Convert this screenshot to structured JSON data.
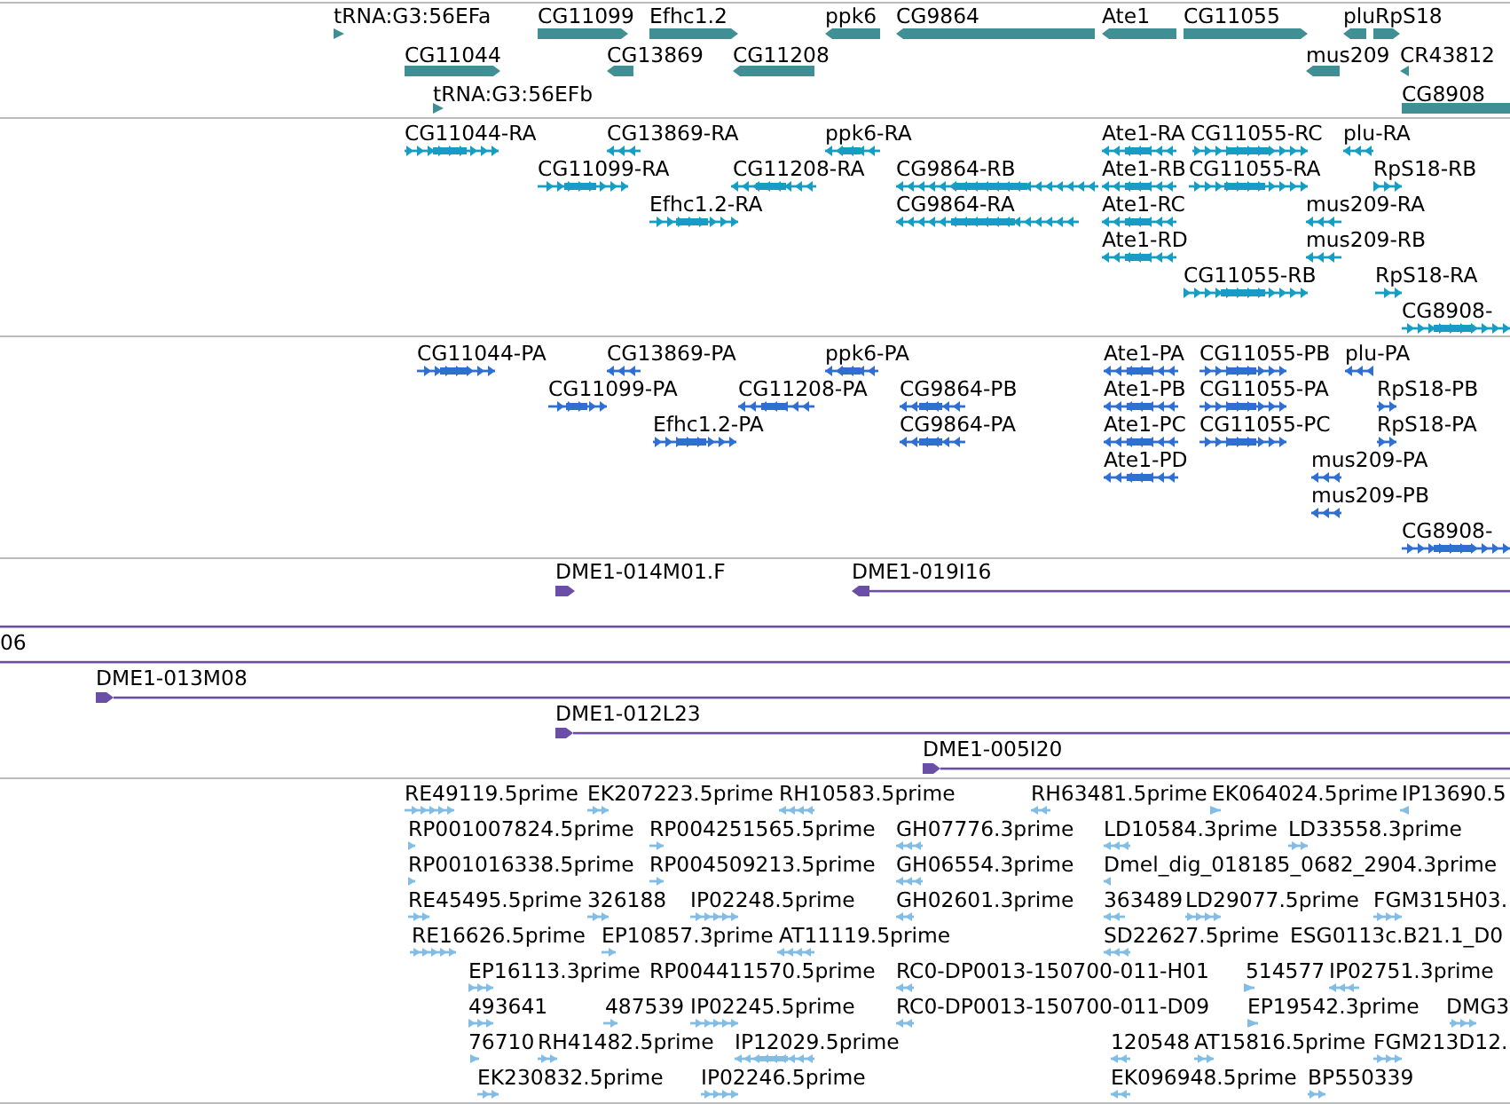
{
  "tracks": [
    {
      "kind": "gene",
      "features": [
        {
          "label": "tRNA:G3:56EFa",
          "reverse": false
        },
        {
          "label": "CG11099",
          "reverse": false
        },
        {
          "label": "Efhc1.2",
          "reverse": false
        },
        {
          "label": "ppk6",
          "reverse": true
        },
        {
          "label": "CG9864",
          "reverse": true
        },
        {
          "label": "Ate1",
          "reverse": true
        },
        {
          "label": "CG11055",
          "reverse": false
        },
        {
          "label": "plu",
          "reverse": true
        },
        {
          "label": "RpS18",
          "reverse": false
        },
        {
          "label": "CG11044",
          "reverse": false
        },
        {
          "label": "CG13869",
          "reverse": true
        },
        {
          "label": "CG11208",
          "reverse": true
        },
        {
          "label": "mus209",
          "reverse": true
        },
        {
          "label": "CR43812",
          "reverse": true
        },
        {
          "label": "tRNA:G3:56EFb",
          "reverse": false
        },
        {
          "label": "CG8908"
        }
      ]
    },
    {
      "kind": "transcript",
      "features": [
        {
          "label": "CG11044-RA",
          "reverse": false
        },
        {
          "label": "CG13869-RA",
          "reverse": true
        },
        {
          "label": "ppk6-RA",
          "reverse": true
        },
        {
          "label": "Ate1-RA",
          "reverse": true
        },
        {
          "label": "CG11055-RC",
          "reverse": false
        },
        {
          "label": "plu-RA",
          "reverse": true
        },
        {
          "label": "CG11099-RA",
          "reverse": false
        },
        {
          "label": "CG11208-RA",
          "reverse": true
        },
        {
          "label": "CG9864-RB",
          "reverse": true
        },
        {
          "label": "Ate1-RB",
          "reverse": true
        },
        {
          "label": "CG11055-RA",
          "reverse": false
        },
        {
          "label": "RpS18-RB",
          "reverse": false
        },
        {
          "label": "Efhc1.2-RA",
          "reverse": false
        },
        {
          "label": "CG9864-RA",
          "reverse": true
        },
        {
          "label": "Ate1-RC",
          "reverse": true
        },
        {
          "label": "mus209-RA",
          "reverse": true
        },
        {
          "label": "Ate1-RD",
          "reverse": true
        },
        {
          "label": "mus209-RB",
          "reverse": true
        },
        {
          "label": "CG11055-RB",
          "reverse": false
        },
        {
          "label": "RpS18-RA",
          "reverse": false
        },
        {
          "label": "CG8908-",
          "reverse": false
        }
      ]
    },
    {
      "kind": "protein",
      "features": [
        {
          "label": "CG11044-PA",
          "reverse": false
        },
        {
          "label": "CG13869-PA",
          "reverse": true
        },
        {
          "label": "ppk6-PA",
          "reverse": true
        },
        {
          "label": "Ate1-PA",
          "reverse": true
        },
        {
          "label": "CG11055-PB",
          "reverse": false
        },
        {
          "label": "plu-PA",
          "reverse": true
        },
        {
          "label": "CG11099-PA",
          "reverse": false
        },
        {
          "label": "CG11208-PA",
          "reverse": true
        },
        {
          "label": "CG9864-PB",
          "reverse": true
        },
        {
          "label": "Ate1-PB",
          "reverse": true
        },
        {
          "label": "CG11055-PA",
          "reverse": false
        },
        {
          "label": "RpS18-PB",
          "reverse": false
        },
        {
          "label": "Efhc1.2-PA",
          "reverse": false
        },
        {
          "label": "CG9864-PA",
          "reverse": true
        },
        {
          "label": "Ate1-PC",
          "reverse": true
        },
        {
          "label": "CG11055-PC",
          "reverse": false
        },
        {
          "label": "RpS18-PA",
          "reverse": false
        },
        {
          "label": "Ate1-PD",
          "reverse": true
        },
        {
          "label": "mus209-PA",
          "reverse": true
        },
        {
          "label": "mus209-PB",
          "reverse": true
        },
        {
          "label": "CG8908-",
          "reverse": false
        }
      ]
    },
    {
      "kind": "clone",
      "features": [
        {
          "label": "DME1-014M01.F",
          "kind": "clone-end",
          "reverse": false
        },
        {
          "label": "DME1-019I16",
          "kind": "clone",
          "reverse": true
        },
        {
          "kind": "clone-through"
        },
        {
          "label": "06",
          "kind": "clone-through"
        },
        {
          "label": "DME1-013M08",
          "kind": "clone",
          "reverse": false
        },
        {
          "label": "DME1-012L23",
          "kind": "clone",
          "reverse": false
        },
        {
          "label": "DME1-005I20",
          "kind": "clone",
          "reverse": false
        }
      ]
    },
    {
      "kind": "est",
      "features": [
        {
          "label": "RE49119.5prime",
          "reverse": false
        },
        {
          "label": "EK207223.5prime",
          "reverse": false
        },
        {
          "label": "RH10583.5prime",
          "reverse": true
        },
        {
          "label": "RH63481.5prime",
          "reverse": true
        },
        {
          "label": "EK064024.5prime",
          "reverse": false
        },
        {
          "label": "IP13690.5",
          "reverse": true
        },
        {
          "label": "RP001007824.5prime",
          "reverse": false
        },
        {
          "label": "RP004251565.5prime",
          "reverse": false
        },
        {
          "label": "GH07776.3prime",
          "reverse": true
        },
        {
          "label": "LD10584.3prime",
          "reverse": true
        },
        {
          "label": "LD33558.3prime",
          "reverse": false
        },
        {
          "label": "RP001016338.5prime",
          "reverse": false
        },
        {
          "label": "RP004509213.5prime",
          "reverse": false
        },
        {
          "label": "GH06554.3prime",
          "reverse": true
        },
        {
          "label": "Dmel_dig_018185_0682_2904.3prime",
          "reverse": true
        },
        {
          "label": "RE45495.5prime",
          "reverse": false
        },
        {
          "label": "326188",
          "reverse": false
        },
        {
          "label": "IP02248.5prime",
          "reverse": false
        },
        {
          "label": "GH02601.3prime",
          "reverse": true
        },
        {
          "label": "363489",
          "reverse": true
        },
        {
          "label": "LD29077.5prime",
          "reverse": false
        },
        {
          "label": "FGM315H03.",
          "reverse": false
        },
        {
          "label": "RE16626.5prime",
          "reverse": false
        },
        {
          "label": "EP10857.3prime",
          "reverse": false
        },
        {
          "label": "AT11119.5prime",
          "reverse": true
        },
        {
          "label": "SD22627.5prime",
          "reverse": true
        },
        {
          "label": "ESG0113c.B21.1_D0"
        },
        {
          "label": "EP16113.3prime",
          "reverse": false
        },
        {
          "label": "RP004411570.5prime"
        },
        {
          "label": "RC0-DP0013-150700-011-H01",
          "reverse": true
        },
        {
          "label": "514577",
          "reverse": false
        },
        {
          "label": "IP02751.3prime",
          "reverse": true
        },
        {
          "label": "493641",
          "reverse": false
        },
        {
          "label": "487539",
          "reverse": false
        },
        {
          "label": "IP02245.5prime",
          "reverse": false
        },
        {
          "label": "RC0-DP0013-150700-011-D09",
          "reverse": true
        },
        {
          "label": "EP19542.3prime",
          "reverse": false
        },
        {
          "label": "DMG3",
          "reverse": false
        },
        {
          "label": "76710",
          "reverse": false
        },
        {
          "label": "RH41482.5prime",
          "reverse": false
        },
        {
          "label": "IP12029.5prime",
          "reverse": true
        },
        {
          "label": "120548",
          "reverse": true
        },
        {
          "label": "AT15816.5prime",
          "reverse": false
        },
        {
          "label": "FGM213D12.",
          "reverse": false
        },
        {
          "label": "EK230832.5prime",
          "reverse": false
        },
        {
          "label": "IP02246.5prime",
          "reverse": false
        },
        {
          "label": "EK096948.5prime",
          "reverse": true
        },
        {
          "label": "BP550339",
          "reverse": false
        }
      ]
    }
  ]
}
